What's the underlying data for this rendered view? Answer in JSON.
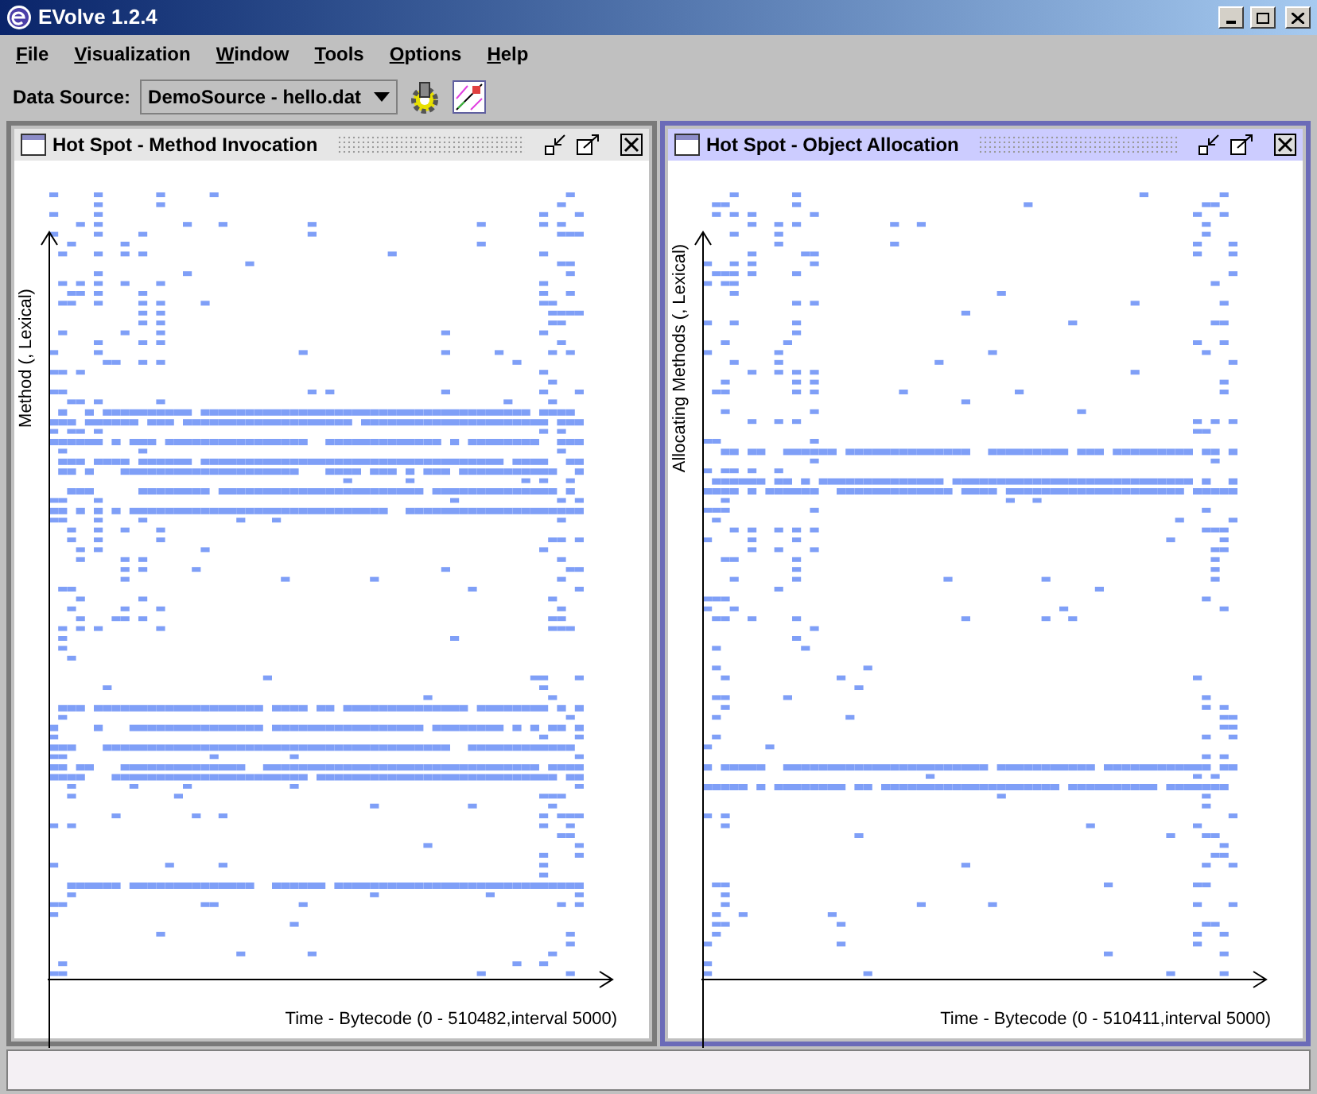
{
  "window": {
    "title": "EVolve 1.2.4"
  },
  "menu": [
    {
      "label": "File"
    },
    {
      "label": "Visualization"
    },
    {
      "label": "Window"
    },
    {
      "label": "Tools"
    },
    {
      "label": "Options"
    },
    {
      "label": "Help"
    }
  ],
  "toolbar": {
    "data_source_label": "Data Source:",
    "data_source_value": "DemoSource - hello.dat"
  },
  "frames": [
    {
      "title": "Hot Spot - Method Invocation",
      "selected": false,
      "ylabel": "Method (, Lexical)",
      "xlabel": "Time - Bytecode (0 - 510482,interval 5000)"
    },
    {
      "title": "Hot Spot - Object Allocation",
      "selected": true,
      "ylabel": "Allocating Methods (, Lexical)",
      "xlabel": "Time - Bytecode (0 - 510411,interval 5000)"
    }
  ]
}
